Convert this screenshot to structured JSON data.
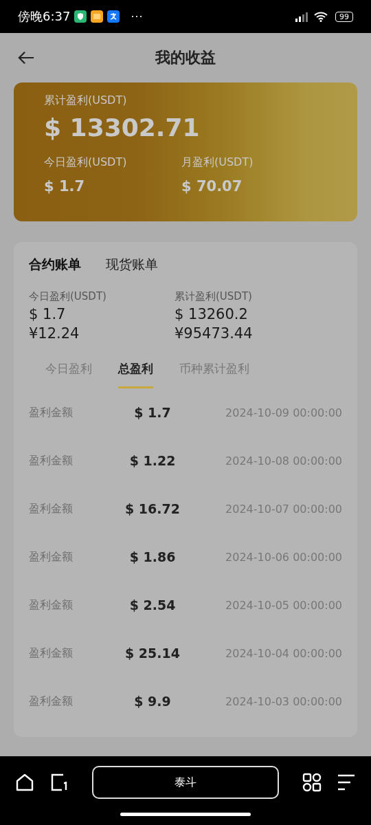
{
  "status_bar": {
    "time": "傍晚6:37",
    "more": "···",
    "battery": "99"
  },
  "header": {
    "title": "我的收益"
  },
  "summary": {
    "total_label": "累计盈利(USDT)",
    "total_value": "$ 13302.71",
    "today_label": "今日盈利(USDT)",
    "today_value": "$ 1.7",
    "month_label": "月盈利(USDT)",
    "month_value": "$ 70.07"
  },
  "account_tabs": [
    {
      "label": "合约账单",
      "selected": true
    },
    {
      "label": "现货账单",
      "selected": false
    }
  ],
  "stats": [
    {
      "label": "今日盈利(USDT)",
      "usd": "$ 1.7",
      "cny": "¥12.24"
    },
    {
      "label": "累计盈利(USDT)",
      "usd": "$ 13260.2",
      "cny": "¥95473.44"
    }
  ],
  "profit_tabs": [
    {
      "label": "今日盈利",
      "selected": false
    },
    {
      "label": "总盈利",
      "selected": true
    },
    {
      "label": "币种累计盈利",
      "selected": false
    }
  ],
  "rows": [
    {
      "label": "盈利金额",
      "amount": "$ 1.7",
      "time": "2024-10-09 00:00:00"
    },
    {
      "label": "盈利金额",
      "amount": "$ 1.22",
      "time": "2024-10-08 00:00:00"
    },
    {
      "label": "盈利金额",
      "amount": "$ 16.72",
      "time": "2024-10-07 00:00:00"
    },
    {
      "label": "盈利金额",
      "amount": "$ 1.86",
      "time": "2024-10-06 00:00:00"
    },
    {
      "label": "盈利金额",
      "amount": "$ 2.54",
      "time": "2024-10-05 00:00:00"
    },
    {
      "label": "盈利金额",
      "amount": "$ 25.14",
      "time": "2024-10-04 00:00:00"
    },
    {
      "label": "盈利金额",
      "amount": "$ 9.9",
      "time": "2024-10-03 00:00:00"
    }
  ],
  "bottom_bar": {
    "address": "泰斗"
  }
}
